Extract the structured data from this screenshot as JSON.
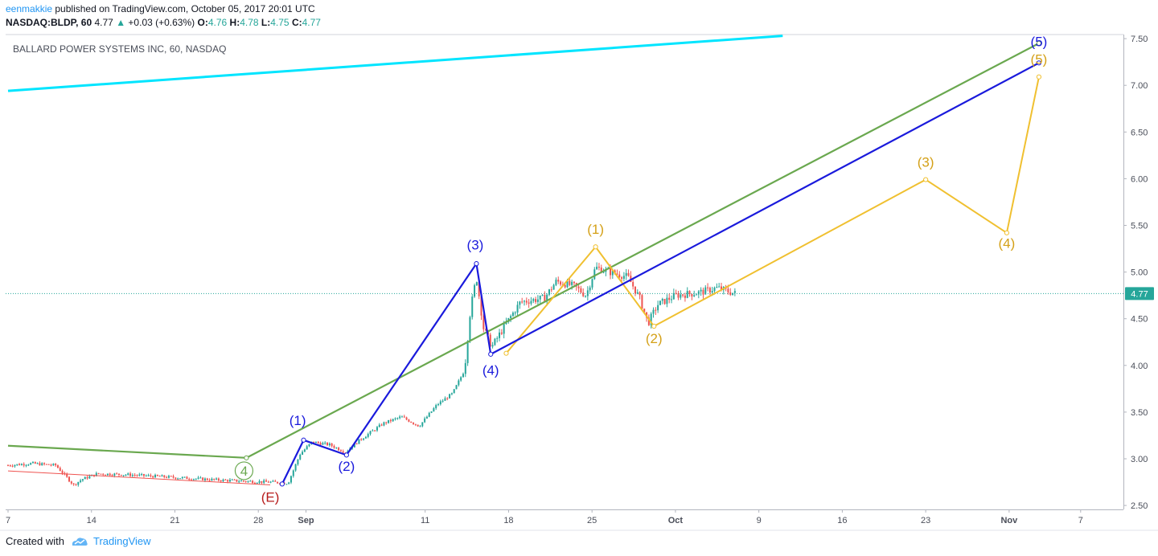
{
  "header": {
    "user": "eenmakkie",
    "published": "published on TradingView.com, October 05, 2017 20:01 UTC",
    "symbol": "NASDAQ:BLDP, 60",
    "last": "4.77",
    "change": "+0.03 (+0.63%)",
    "o_label": "O:",
    "o": "4.76",
    "h_label": "H:",
    "h": "4.78",
    "l_label": "L:",
    "l": "4.75",
    "c_label": "C:",
    "c": "4.77"
  },
  "footer": {
    "created_with": "Created with",
    "brand": "TradingView"
  },
  "colors": {
    "up": "#26a69a",
    "down": "#ef5350",
    "cyan": "#00e5ff",
    "green": "#6aa84f",
    "blue": "#1a1adc",
    "gold": "#f0c030",
    "red_label": "#b71c1c",
    "price_tag": "#26a69a"
  },
  "chart_data": {
    "type": "candlestick",
    "title": "BALLARD POWER SYSTEMS INC, 60, NASDAQ",
    "last_price_label": "4.77",
    "ylim": [
      2.45,
      7.55
    ],
    "y_ticks": [
      2.5,
      3.0,
      3.5,
      4.0,
      4.5,
      5.0,
      5.5,
      6.0,
      6.5,
      7.0,
      7.5
    ],
    "y_tick_labels": [
      "2.50",
      "3.00",
      "3.50",
      "4.00",
      "4.50",
      "5.00",
      "5.50",
      "6.00",
      "6.50",
      "7.00",
      "7.50"
    ],
    "x_ticks": [
      {
        "day": 7,
        "label": "7"
      },
      {
        "day": 14,
        "label": "14"
      },
      {
        "day": 21,
        "label": "21"
      },
      {
        "day": 28,
        "label": "28"
      },
      {
        "day": 32,
        "label": "Sep"
      },
      {
        "day": 42,
        "label": "11"
      },
      {
        "day": 49,
        "label": "18"
      },
      {
        "day": 56,
        "label": "25"
      },
      {
        "day": 63,
        "label": "Oct"
      },
      {
        "day": 70,
        "label": "9"
      },
      {
        "day": 77,
        "label": "16"
      },
      {
        "day": 84,
        "label": "23"
      },
      {
        "day": 91,
        "label": "Nov"
      },
      {
        "day": 97,
        "label": "7"
      }
    ],
    "price_path": [
      {
        "day": 7.0,
        "price": 2.93
      },
      {
        "day": 9.0,
        "price": 2.95
      },
      {
        "day": 11.0,
        "price": 2.93
      },
      {
        "day": 12.5,
        "price": 2.72
      },
      {
        "day": 13.2,
        "price": 2.78
      },
      {
        "day": 14.5,
        "price": 2.84
      },
      {
        "day": 17.0,
        "price": 2.83
      },
      {
        "day": 21.0,
        "price": 2.8
      },
      {
        "day": 25.0,
        "price": 2.77
      },
      {
        "day": 29.0,
        "price": 2.75
      },
      {
        "day": 30.5,
        "price": 2.74
      },
      {
        "day": 31.5,
        "price": 3.05
      },
      {
        "day": 32.5,
        "price": 3.18
      },
      {
        "day": 34.0,
        "price": 3.15
      },
      {
        "day": 35.3,
        "price": 3.07
      },
      {
        "day": 36.5,
        "price": 3.2
      },
      {
        "day": 38.5,
        "price": 3.38
      },
      {
        "day": 40.0,
        "price": 3.45
      },
      {
        "day": 41.5,
        "price": 3.35
      },
      {
        "day": 43.0,
        "price": 3.58
      },
      {
        "day": 44.3,
        "price": 3.7
      },
      {
        "day": 45.3,
        "price": 3.95
      },
      {
        "day": 45.8,
        "price": 4.6
      },
      {
        "day": 46.3,
        "price": 4.95
      },
      {
        "day": 46.9,
        "price": 4.4
      },
      {
        "day": 47.6,
        "price": 4.2
      },
      {
        "day": 48.8,
        "price": 4.45
      },
      {
        "day": 50.0,
        "price": 4.68
      },
      {
        "day": 52.0,
        "price": 4.72
      },
      {
        "day": 53.0,
        "price": 4.9
      },
      {
        "day": 54.5,
        "price": 4.85
      },
      {
        "day": 55.5,
        "price": 4.75
      },
      {
        "day": 56.3,
        "price": 5.05
      },
      {
        "day": 57.5,
        "price": 5.0
      },
      {
        "day": 59.0,
        "price": 4.95
      },
      {
        "day": 60.0,
        "price": 4.72
      },
      {
        "day": 60.7,
        "price": 4.45
      },
      {
        "day": 61.5,
        "price": 4.65
      },
      {
        "day": 63.0,
        "price": 4.75
      },
      {
        "day": 65.0,
        "price": 4.78
      },
      {
        "day": 66.5,
        "price": 4.83
      },
      {
        "day": 68.0,
        "price": 4.77
      }
    ],
    "annotations": [
      {
        "label": "(E)",
        "day": 29.0,
        "price": 2.54,
        "color": "red"
      },
      {
        "label": "4",
        "day": 26.8,
        "price": 2.82,
        "color": "green",
        "circled": true
      },
      {
        "label": "(1)",
        "day": 31.3,
        "price": 3.36,
        "color": "blue"
      },
      {
        "label": "(2)",
        "day": 35.4,
        "price": 2.87,
        "color": "blue"
      },
      {
        "label": "(3)",
        "day": 46.2,
        "price": 5.24,
        "color": "blue"
      },
      {
        "label": "(4)",
        "day": 47.5,
        "price": 3.9,
        "color": "blue"
      },
      {
        "label": "(5)",
        "day": 93.5,
        "price": 7.42,
        "color": "blue"
      },
      {
        "label": "(1)",
        "day": 56.3,
        "price": 5.41,
        "color": "gold"
      },
      {
        "label": "(2)",
        "day": 61.2,
        "price": 4.24,
        "color": "gold"
      },
      {
        "label": "(3)",
        "day": 84.0,
        "price": 6.13,
        "color": "gold"
      },
      {
        "label": "(4)",
        "day": 90.8,
        "price": 5.26,
        "color": "gold"
      },
      {
        "label": "(5)",
        "day": 93.5,
        "price": 7.23,
        "color": "gold"
      }
    ],
    "lines": {
      "cyan_trend": [
        {
          "day": 7.0,
          "price": 6.94
        },
        {
          "day": 72.0,
          "price": 7.53
        }
      ],
      "green_channel": [
        {
          "day": 7.0,
          "price": 3.14
        },
        {
          "day": 27.0,
          "price": 3.01
        },
        {
          "day": 93.5,
          "price": 7.45
        }
      ],
      "blue_waves": [
        {
          "day": 30.0,
          "price": 2.73
        },
        {
          "day": 31.8,
          "price": 3.2
        },
        {
          "day": 35.4,
          "price": 3.04
        },
        {
          "day": 46.3,
          "price": 5.09
        },
        {
          "day": 47.5,
          "price": 4.12
        },
        {
          "day": 93.5,
          "price": 7.24
        }
      ],
      "gold_waves": [
        {
          "day": 48.8,
          "price": 4.13
        },
        {
          "day": 56.3,
          "price": 5.27
        },
        {
          "day": 61.2,
          "price": 4.42
        },
        {
          "day": 84.0,
          "price": 5.99
        },
        {
          "day": 90.8,
          "price": 5.42
        },
        {
          "day": 93.5,
          "price": 7.09
        }
      ],
      "red_support": [
        {
          "day": 7.0,
          "price": 2.87
        },
        {
          "day": 29.0,
          "price": 2.72
        }
      ]
    }
  }
}
